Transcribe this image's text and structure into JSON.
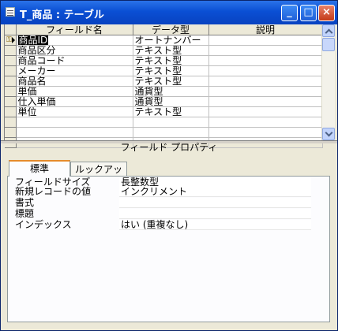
{
  "window": {
    "title": "T_商品 : テーブル"
  },
  "window_buttons": {
    "minimize": "_",
    "maximize": "□",
    "close": "×"
  },
  "grid": {
    "headers": [
      "フィールド名",
      "データ型",
      "説明"
    ],
    "rows": [
      {
        "name": "商品ID",
        "type": "オートナンバー",
        "desc": ""
      },
      {
        "name": "商品区分",
        "type": "テキスト型",
        "desc": ""
      },
      {
        "name": "商品コード",
        "type": "テキスト型",
        "desc": ""
      },
      {
        "name": "メーカー",
        "type": "テキスト型",
        "desc": ""
      },
      {
        "name": "商品名",
        "type": "テキスト型",
        "desc": ""
      },
      {
        "name": "単価",
        "type": "通貨型",
        "desc": ""
      },
      {
        "name": "仕入単価",
        "type": "通貨型",
        "desc": ""
      },
      {
        "name": "単位",
        "type": "テキスト型",
        "desc": ""
      }
    ],
    "key_icon": "key-icon"
  },
  "field_properties": {
    "title": "フィールド プロパティ",
    "tabs": [
      "標準",
      "ルックアップ"
    ],
    "active_tab": "標準",
    "properties": [
      {
        "label": "フィールドサイズ",
        "value": "長整数型"
      },
      {
        "label": "新規レコードの値",
        "value": "インクリメント"
      },
      {
        "label": "書式",
        "value": ""
      },
      {
        "label": "標題",
        "value": ""
      },
      {
        "label": "インデックス",
        "value": "はい (重複なし)"
      }
    ]
  },
  "colors": {
    "titlebar": "#0a4fd4",
    "selection": "#000000",
    "active_tab_accent": "#e68b2c"
  }
}
